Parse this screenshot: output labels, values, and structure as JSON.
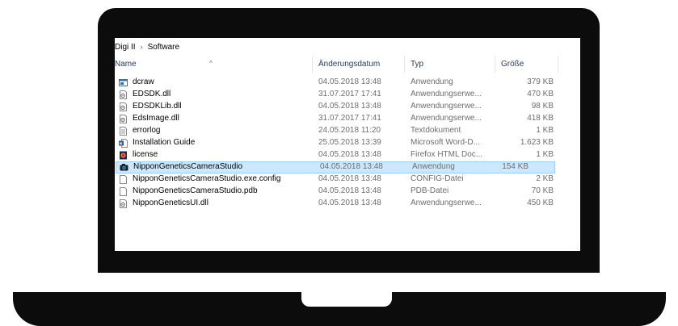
{
  "breadcrumb": {
    "folder": "Digi II",
    "sep": "›",
    "current": "Software"
  },
  "columns": {
    "name": "Name",
    "date": "Änderungsdatum",
    "type": "Typ",
    "size": "Größe",
    "sort_arrow": "^"
  },
  "files": [
    {
      "name": "dcraw",
      "date": "04.05.2018 13:48",
      "type": "Anwendung",
      "size": "379 KB",
      "icon": "exe-window-icon"
    },
    {
      "name": "EDSDK.dll",
      "date": "31.07.2017 17:41",
      "type": "Anwendungserwe...",
      "size": "470 KB",
      "icon": "dll-gear-icon"
    },
    {
      "name": "EDSDKLib.dll",
      "date": "04.05.2018 13:48",
      "type": "Anwendungserwe...",
      "size": "98 KB",
      "icon": "dll-gear-icon"
    },
    {
      "name": "EdsImage.dll",
      "date": "31.07.2017 17:41",
      "type": "Anwendungserwe...",
      "size": "418 KB",
      "icon": "dll-gear-icon"
    },
    {
      "name": "errorlog",
      "date": "24.05.2018 11:20",
      "type": "Textdokument",
      "size": "1 KB",
      "icon": "text-document-icon"
    },
    {
      "name": "Installation Guide",
      "date": "25.05.2018 13:39",
      "type": "Microsoft Word-D...",
      "size": "1.623 KB",
      "icon": "word-document-icon"
    },
    {
      "name": "license",
      "date": "04.05.2018 13:48",
      "type": "Firefox HTML Doc...",
      "size": "1 KB",
      "icon": "firefox-html-icon"
    },
    {
      "name": "NipponGeneticsCameraStudio",
      "date": "04.05.2018 13:48",
      "type": "Anwendung",
      "size": "154 KB",
      "icon": "camera-app-icon",
      "selected": true
    },
    {
      "name": "NipponGeneticsCameraStudio.exe.config",
      "date": "04.05.2018 13:48",
      "type": "CONFIG-Datei",
      "size": "2 KB",
      "icon": "blank-file-icon"
    },
    {
      "name": "NipponGeneticsCameraStudio.pdb",
      "date": "04.05.2018 13:48",
      "type": "PDB-Datei",
      "size": "70 KB",
      "icon": "blank-file-icon"
    },
    {
      "name": "NipponGeneticsUI.dll",
      "date": "04.05.2018 13:48",
      "type": "Anwendungserwe...",
      "size": "450 KB",
      "icon": "dll-gear-icon"
    }
  ],
  "colors": {
    "selection": "#cce8ff",
    "selection_border": "#99d1ff",
    "header_text": "#1e3a5f",
    "meta_text": "#6d6d6d",
    "device": "#0c0c0c"
  }
}
